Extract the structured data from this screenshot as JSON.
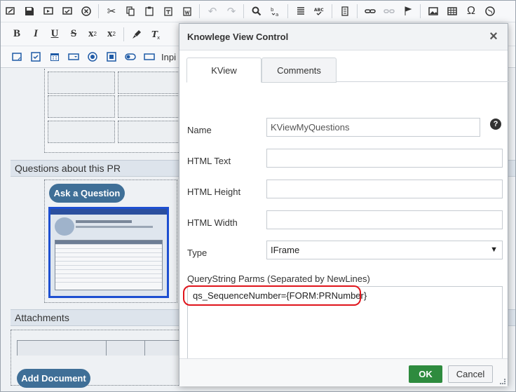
{
  "toolbar": {
    "row1_icons": [
      "source-view-icon",
      "save-icon",
      "save-and-close-icon",
      "validate-icon",
      "cancel-icon",
      "cut-icon",
      "copy-icon",
      "paste-icon",
      "paste-text-icon",
      "paste-word-icon",
      "undo-icon",
      "redo-icon",
      "find-icon",
      "replace-icon",
      "format-icon",
      "spellcheck-icon",
      "show-blocks-icon",
      "link-icon",
      "unlink-icon",
      "anchor-icon",
      "image-icon",
      "table-icon",
      "special-char-icon",
      "web-icon"
    ],
    "row2": {
      "bold": "B",
      "italic": "I",
      "underline": "U",
      "strike": "S",
      "subscript": "x",
      "subscript_mark": "2",
      "superscript": "x",
      "superscript_mark": "2"
    },
    "row3_label": "Inpi"
  },
  "canvas": {
    "questions_header": "Questions about this PR",
    "ask_button": "Ask a Question",
    "attachments_header": "Attachments",
    "add_document_button": "Add Document"
  },
  "modal": {
    "title": "Knowlege View Control",
    "close_icon": "close-icon",
    "tabs": [
      {
        "label": "KView",
        "active": true
      },
      {
        "label": "Comments",
        "active": false
      }
    ],
    "fields": {
      "name": {
        "label": "Name",
        "value": "KViewMyQuestions"
      },
      "html_text": {
        "label": "HTML Text",
        "value": ""
      },
      "html_height": {
        "label": "HTML Height",
        "value": ""
      },
      "html_width": {
        "label": "HTML Width",
        "value": ""
      },
      "type": {
        "label": "Type",
        "value": "IFrame"
      },
      "querystring": {
        "label": "QueryString Parms (Separated by NewLines)",
        "value": "qs_SequenceNumber={FORM:PRNumber}"
      }
    },
    "help_glyph": "?",
    "ok_label": "OK",
    "cancel_label": "Cancel"
  },
  "colors": {
    "ok_green": "#2e8b3e",
    "highlight_red": "#e0141b",
    "button_blue": "#3f6f97"
  }
}
